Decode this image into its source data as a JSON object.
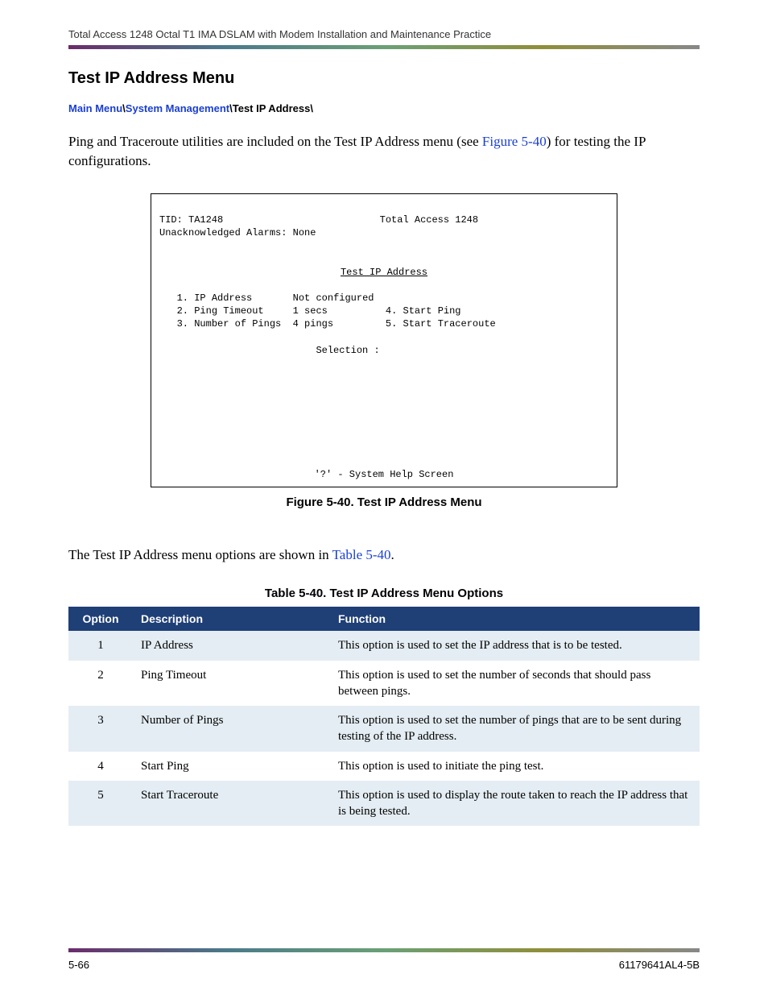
{
  "header": {
    "title": "Total Access 1248 Octal T1 IMA DSLAM with Modem Installation and Maintenance Practice"
  },
  "section": {
    "title": "Test IP Address Menu"
  },
  "breadcrumb": {
    "items": [
      "Main Menu",
      "System Management"
    ],
    "current": "Test IP Address"
  },
  "intro": {
    "before_link": "Ping and Traceroute utilities are included on the Test IP Address menu (see ",
    "link": "Figure 5-40",
    "after_link": ") for testing the IP configurations."
  },
  "terminal": {
    "tid_label": "TID: TA1248",
    "device": "Total Access 1248",
    "alarms": "Unacknowledged Alarms: None",
    "title": "Test IP Address",
    "items_left": [
      {
        "num": "1.",
        "label": "IP Address",
        "value": "Not configured"
      },
      {
        "num": "2.",
        "label": "Ping Timeout",
        "value": "1 secs"
      },
      {
        "num": "3.",
        "label": "Number of Pings",
        "value": "4 pings"
      }
    ],
    "items_right": [
      {
        "num": "4.",
        "label": "Start Ping"
      },
      {
        "num": "5.",
        "label": "Start Traceroute"
      }
    ],
    "selection_label": "Selection :",
    "help": "'?' - System Help Screen"
  },
  "figure_caption": "Figure 5-40.  Test IP Address Menu",
  "mid_text": {
    "before_link": "The Test IP Address menu options are shown in ",
    "link": "Table 5-40",
    "after_link": "."
  },
  "table": {
    "caption": "Table 5-40.  Test IP Address Menu Options",
    "headers": [
      "Option",
      "Description",
      "Function"
    ],
    "rows": [
      {
        "option": "1",
        "desc": "IP Address",
        "func": "This option is used to set the IP address that is to be tested."
      },
      {
        "option": "2",
        "desc": "Ping Timeout",
        "func": "This option is used to set the number of seconds that should pass between pings."
      },
      {
        "option": "3",
        "desc": "Number of Pings",
        "func": "This option is used to set the number of pings that are to be sent during testing of the IP address."
      },
      {
        "option": "4",
        "desc": "Start Ping",
        "func": "This option is used to initiate the ping test."
      },
      {
        "option": "5",
        "desc": "Start Traceroute",
        "func": "This option is used to display the route taken to reach the IP address that is being tested."
      }
    ]
  },
  "footer": {
    "page": "5-66",
    "doc": "61179641AL4-5B"
  }
}
